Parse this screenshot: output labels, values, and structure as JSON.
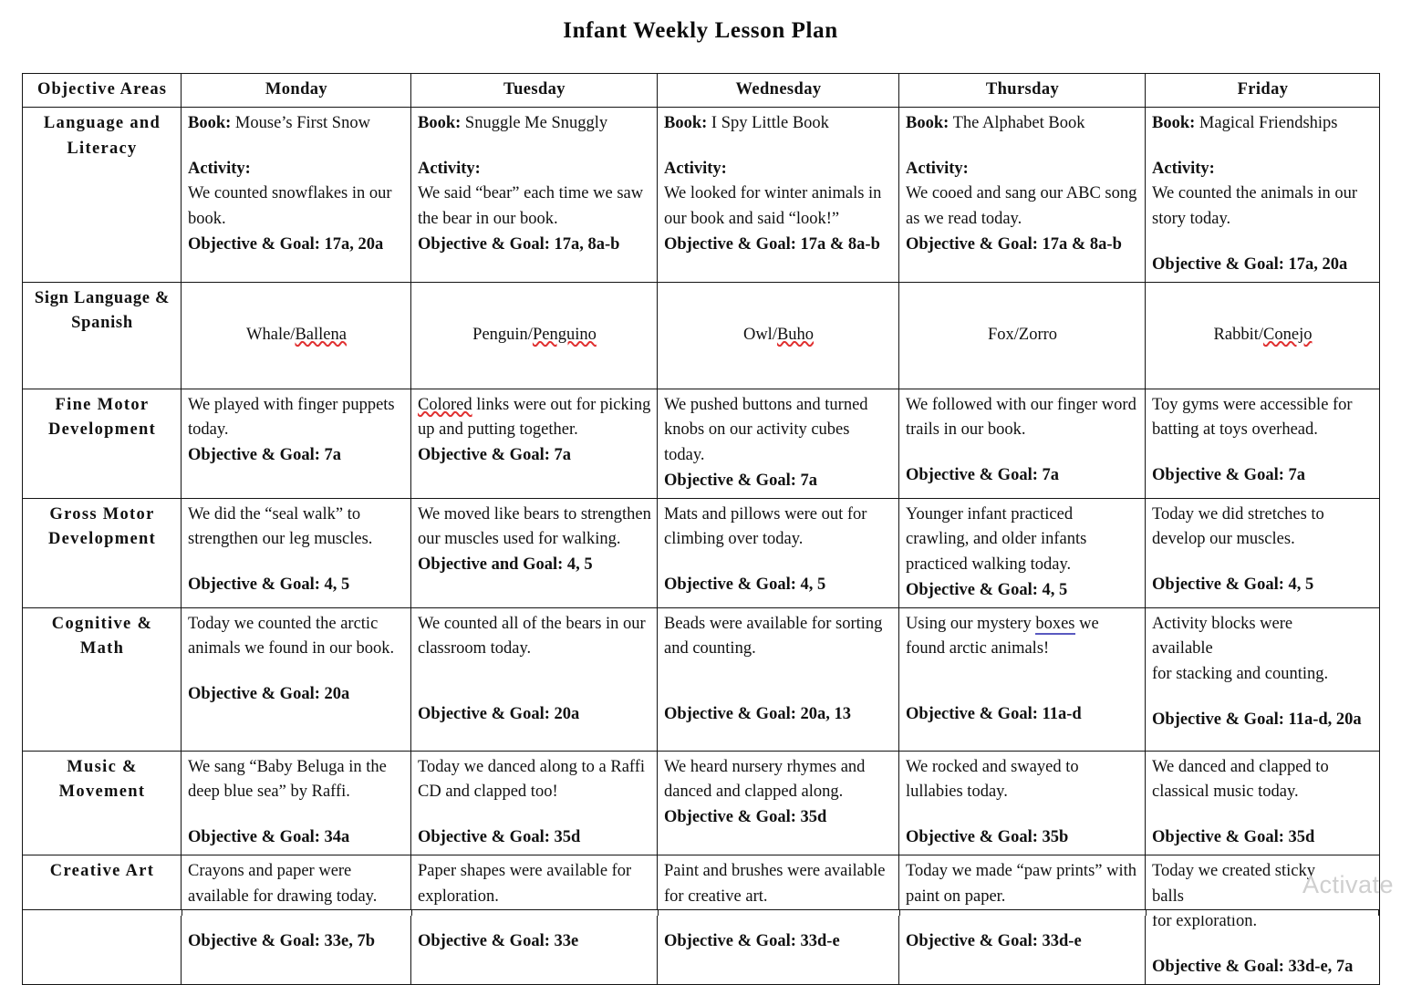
{
  "document": {
    "title": "Infant Weekly Lesson Plan",
    "watermark": "Activate"
  },
  "table": {
    "headers": {
      "objective_areas": "Objective  Areas",
      "monday": "Monday",
      "tuesday": "Tuesday",
      "wednesday": "Wednesday",
      "thursday": "Thursday",
      "friday": "Friday"
    },
    "rows": {
      "language": {
        "area_line1": "Language and",
        "area_line2": "Literacy",
        "monday": {
          "book_label": "Book:",
          "book_title": " Mouse’s First Snow",
          "activity_label": "Activity:",
          "activity_text": "We counted snowflakes in our book.",
          "goal": "Objective  & Goal: 17a, 20a"
        },
        "tuesday": {
          "book_label": "Book:",
          "book_title": " Snuggle Me Snuggly",
          "activity_label": "Activity:",
          "activity_text": "We said “bear” each time we saw the bear in our book.",
          "goal": "Objective  & Goal: 17a, 8a-b"
        },
        "wednesday": {
          "book_label": "Book:",
          "book_title": " I Spy Little Book",
          "activity_label": "Activity:",
          "activity_text": "We looked for winter animals in our book and said “look!”",
          "goal": "Objective  & Goal: 17a & 8a-b"
        },
        "thursday": {
          "book_label": "Book:",
          "book_title": " The Alphabet Book",
          "activity_label": "Activity:",
          "activity_text": "We cooed and sang our ABC song as we read today.",
          "goal": "Objective  & Goal: 17a & 8a-b"
        },
        "friday": {
          "book_label": "Book:",
          "book_title": " Magical Friendships",
          "activity_label": "Activity:",
          "activity_text": "We counted the animals in our story today.",
          "goal": "Objective  & Goal: 17a, 20a"
        }
      },
      "sign_language": {
        "area_line1": "Sign Language",
        "area_line2": "&",
        "area_line3": "Spanish",
        "monday_en": "Whale/",
        "monday_es": "Ballena",
        "tuesday_en": "Penguin/",
        "tuesday_es": "Penguino",
        "wednesday_en": "Owl/",
        "wednesday_es": "Buho",
        "thursday_en": "Fox/Zorro",
        "friday_en": "Rabbit/",
        "friday_es": "Conejo"
      },
      "fine_motor": {
        "area_line1": "Fine  Motor",
        "area_line2": "Development",
        "monday": {
          "text": "We played with finger puppets today.",
          "goal": "Objective  & Goal: 7a"
        },
        "tuesday": {
          "misspelled": "Colored",
          "text": " links were out for picking up and putting together.",
          "goal": "Objective  & Goal: 7a"
        },
        "wednesday": {
          "text": "We pushed buttons and turned knobs on our activity cubes today.",
          "goal": "Objective  & Goal: 7a"
        },
        "thursday": {
          "text": "We followed with our finger word trails in our book.",
          "goal": "Objective  & Goal: 7a"
        },
        "friday": {
          "text": "Toy gyms were accessible for batting at toys overhead.",
          "goal": "Objective  & Goal: 7a"
        }
      },
      "gross_motor": {
        "area_line1": "Gross Motor",
        "area_line2": "Development",
        "monday": {
          "text": "We did the “seal walk” to strengthen our leg muscles.",
          "goal": "Objective  & Goal: 4, 5"
        },
        "tuesday": {
          "text": "We moved like bears to strengthen our muscles used for walking.",
          "goal": "Objective  and Goal: 4, 5"
        },
        "wednesday": {
          "text": "Mats and pillows were out for climbing over today.",
          "goal": "Objective  & Goal: 4, 5"
        },
        "thursday": {
          "text": "Younger infant practiced crawling, and older infants practiced walking today.",
          "goal": "Objective  & Goal: 4, 5"
        },
        "friday": {
          "text": "Today we did stretches to develop our muscles.",
          "goal": "Objective  & Goal: 4, 5"
        }
      },
      "cognitive": {
        "area_line1": "Cognitive  &",
        "area_line2": "Math",
        "monday": {
          "text": "Today we counted the arctic animals we found in our book.",
          "goal": "Objective  & Goal: 20a"
        },
        "tuesday": {
          "text": "We counted all of the bears in our classroom today.",
          "goal": "Objective  & Goal: 20a"
        },
        "wednesday": {
          "text": "Beads were available for sorting and counting.",
          "goal": "Objective  & Goal: 20a, 13"
        },
        "thursday": {
          "text_before": "Using our mystery ",
          "grammar_word": "boxes",
          "text_after": " we found arctic animals!",
          "goal": "Objective  & Goal: 11a-d"
        },
        "friday": {
          "line1": "Activity blocks were",
          "line2": "available",
          "line3": "for stacking and counting.",
          "goal": "Objective  & Goal: 11a-d, 20a"
        }
      },
      "music": {
        "area_line1": "Music &",
        "area_line2": "Movement",
        "monday": {
          "text": "We sang “Baby Beluga in the deep blue sea” by Raffi.",
          "goal": "Objective  & Goal: 34a"
        },
        "tuesday": {
          "text": "Today we danced along to a Raffi CD and clapped too!",
          "goal": "Objective  & Goal: 35d"
        },
        "wednesday": {
          "text": "We heard nursery rhymes and danced and clapped along.",
          "goal": "Objective  & Goal: 35d"
        },
        "thursday": {
          "text": "We rocked and swayed to lullabies today.",
          "goal": "Objective  & Goal: 35b"
        },
        "friday": {
          "text": "We danced and clapped to classical music today.",
          "goal": "Objective  & Goal: 35d"
        }
      },
      "creative_art": {
        "area_line1": "Creative  Art",
        "monday": {
          "text": "Crayons and paper were available for drawing today.",
          "goal": "Objective  & Goal: 33e, 7b"
        },
        "tuesday": {
          "text": "Paper shapes were available for exploration.",
          "goal": "Objective  & Goal: 33e"
        },
        "wednesday": {
          "text": "Paint and brushes were available for creative art.",
          "goal": "Objective  & Goal: 33d-e"
        },
        "thursday": {
          "text": "Today we made “paw prints” with paint on paper.",
          "goal": "Objective  & Goal: 33d-e"
        },
        "friday": {
          "line1": "Today we created sticky",
          "line2": "balls",
          "line3": "for exploration.",
          "goal": "Objective  & Goal: 33d-e, 7a"
        }
      }
    }
  }
}
